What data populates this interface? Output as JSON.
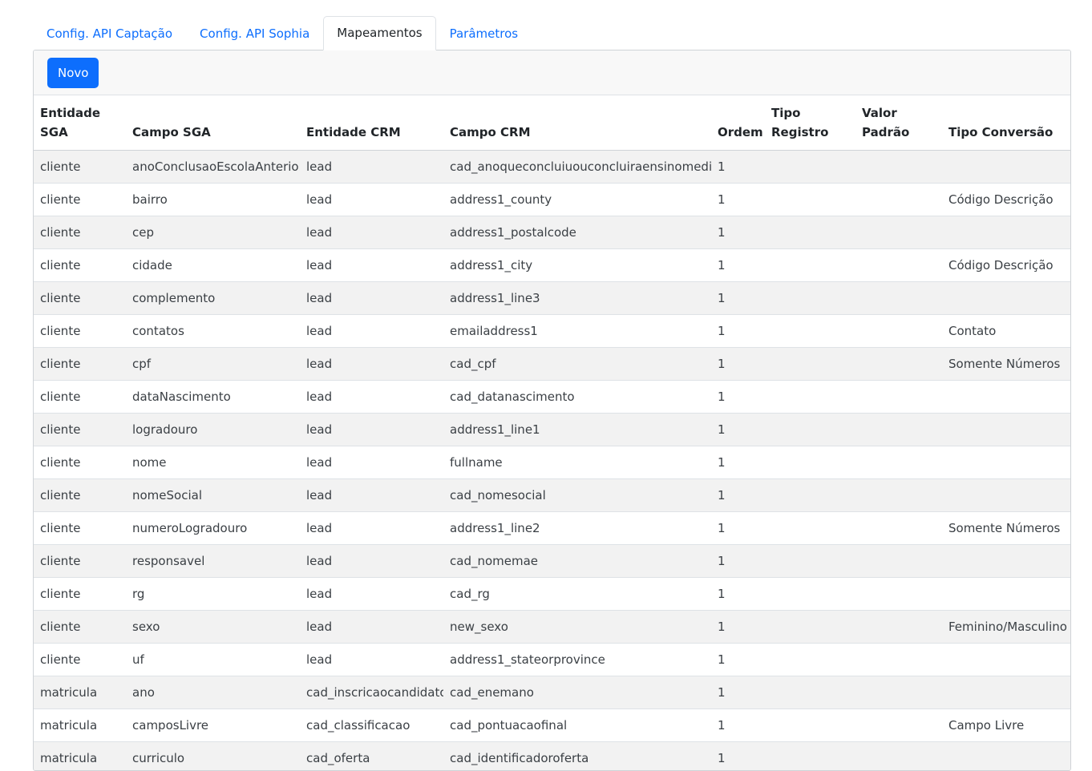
{
  "tabs": [
    {
      "label": "Config. API Captação",
      "active": false
    },
    {
      "label": "Config. API Sophia",
      "active": false
    },
    {
      "label": "Mapeamentos",
      "active": true
    },
    {
      "label": "Parâmetros",
      "active": false
    }
  ],
  "toolbar": {
    "new_label": "Novo"
  },
  "table": {
    "headers": {
      "entidade_sga": "Entidade SGA",
      "campo_sga": "Campo SGA",
      "entidade_crm": "Entidade CRM",
      "campo_crm": "Campo CRM",
      "ordem": "Ordem",
      "tipo_registro": "Tipo Registro",
      "valor_padrao": "Valor Padrão",
      "tipo_conversao": "Tipo Conversão"
    },
    "rows": [
      [
        "cliente",
        "anoConclusaoEscolaAnterior",
        "lead",
        "cad_anoqueconcluiuouconcluiraensinomedio",
        "1",
        "",
        "",
        ""
      ],
      [
        "cliente",
        "bairro",
        "lead",
        "address1_county",
        "1",
        "",
        "",
        "Código Descrição"
      ],
      [
        "cliente",
        "cep",
        "lead",
        "address1_postalcode",
        "1",
        "",
        "",
        ""
      ],
      [
        "cliente",
        "cidade",
        "lead",
        "address1_city",
        "1",
        "",
        "",
        "Código Descrição"
      ],
      [
        "cliente",
        "complemento",
        "lead",
        "address1_line3",
        "1",
        "",
        "",
        ""
      ],
      [
        "cliente",
        "contatos",
        "lead",
        "emailaddress1",
        "1",
        "",
        "",
        "Contato"
      ],
      [
        "cliente",
        "cpf",
        "lead",
        "cad_cpf",
        "1",
        "",
        "",
        "Somente Números"
      ],
      [
        "cliente",
        "dataNascimento",
        "lead",
        "cad_datanascimento",
        "1",
        "",
        "",
        ""
      ],
      [
        "cliente",
        "logradouro",
        "lead",
        "address1_line1",
        "1",
        "",
        "",
        ""
      ],
      [
        "cliente",
        "nome",
        "lead",
        "fullname",
        "1",
        "",
        "",
        ""
      ],
      [
        "cliente",
        "nomeSocial",
        "lead",
        "cad_nomesocial",
        "1",
        "",
        "",
        ""
      ],
      [
        "cliente",
        "numeroLogradouro",
        "lead",
        "address1_line2",
        "1",
        "",
        "",
        "Somente Números"
      ],
      [
        "cliente",
        "responsavel",
        "lead",
        "cad_nomemae",
        "1",
        "",
        "",
        ""
      ],
      [
        "cliente",
        "rg",
        "lead",
        "cad_rg",
        "1",
        "",
        "",
        ""
      ],
      [
        "cliente",
        "sexo",
        "lead",
        "new_sexo",
        "1",
        "",
        "",
        "Feminino/Masculino"
      ],
      [
        "cliente",
        "uf",
        "lead",
        "address1_stateorprovince",
        "1",
        "",
        "",
        ""
      ],
      [
        "matricula",
        "ano",
        "cad_inscricaocandidato",
        "cad_enemano",
        "1",
        "",
        "",
        ""
      ],
      [
        "matricula",
        "camposLivre",
        "cad_classificacao",
        "cad_pontuacaofinal",
        "1",
        "",
        "",
        "Campo Livre"
      ],
      [
        "matricula",
        "curriculo",
        "cad_oferta",
        "cad_identificadoroferta",
        "1",
        "",
        "",
        ""
      ]
    ]
  }
}
